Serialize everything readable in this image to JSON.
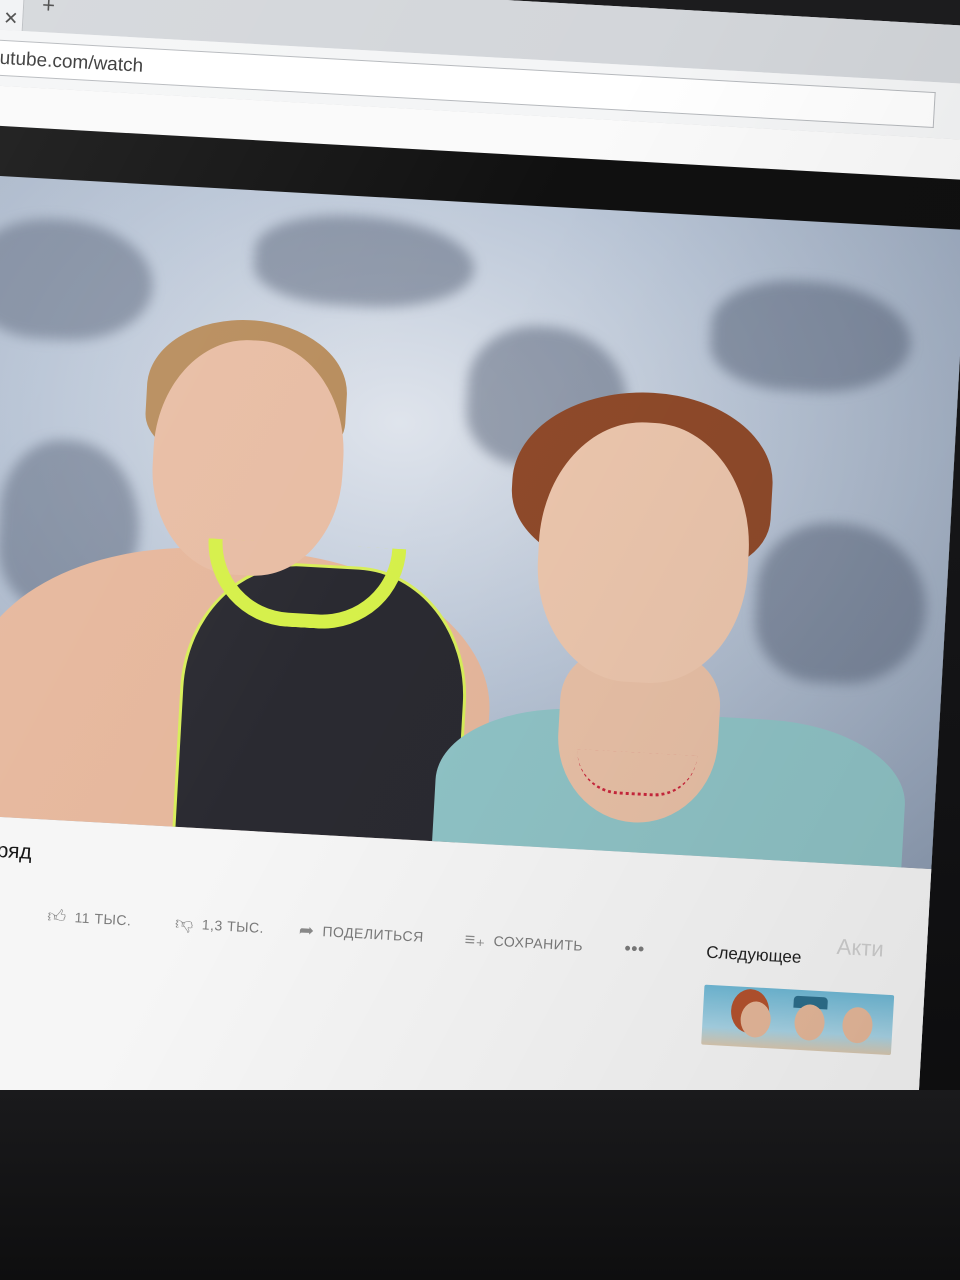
{
  "browser": {
    "tab_close": "✕",
    "new_tab": "+",
    "url": "outube.com/watch"
  },
  "video": {
    "title": "рии подряд",
    "likes": "11 ТЫС.",
    "dislikes": "1,3 ТЫС.",
    "share_label": "ПОДЕЛИТЬСЯ",
    "save_label": "СОХРАНИТЬ",
    "more_label": "•••"
  },
  "sidebar": {
    "next_label": "Следующее"
  },
  "overlay": {
    "activation_watermark": "Акти"
  },
  "icons": {
    "like": "thumbs-up-icon",
    "dislike": "thumbs-down-icon",
    "share": "share-arrow-icon",
    "save": "playlist-add-icon",
    "keyboard": "keyboard-icon",
    "search": "search-icon"
  },
  "colors": {
    "swimsuit_trim": "#d8ee5a",
    "dress": "#8fc3c6",
    "hair_right": "#8f4a2a"
  }
}
